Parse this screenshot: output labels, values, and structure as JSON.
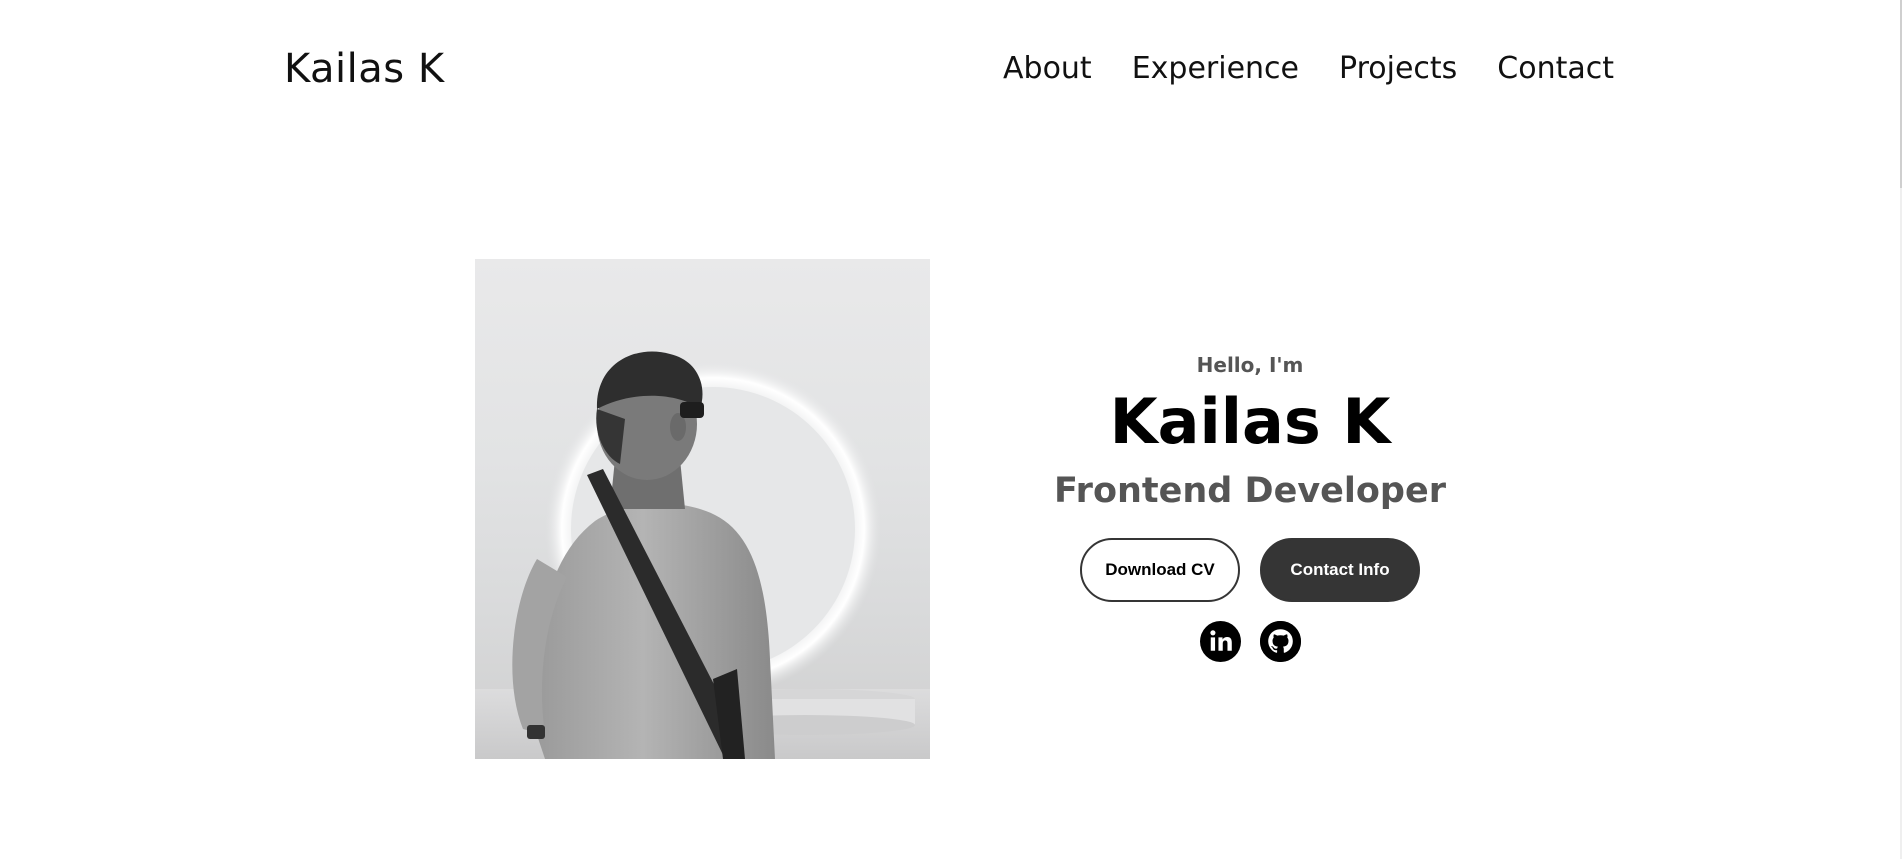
{
  "nav": {
    "logo": "Kailas K",
    "links": [
      {
        "label": "About"
      },
      {
        "label": "Experience"
      },
      {
        "label": "Projects"
      },
      {
        "label": "Contact"
      }
    ]
  },
  "hero": {
    "greeting": "Hello, I'm",
    "name": "Kailas K",
    "role": "Frontend Developer",
    "buttons": {
      "download_cv": "Download CV",
      "contact_info": "Contact Info"
    },
    "socials": [
      {
        "icon": "linkedin-icon"
      },
      {
        "icon": "github-icon"
      }
    ],
    "photo": {
      "icon": "profile-photo"
    }
  },
  "colors": {
    "text": "#111111",
    "muted": "#555555",
    "button_dark": "#353535",
    "background": "#ffffff"
  }
}
